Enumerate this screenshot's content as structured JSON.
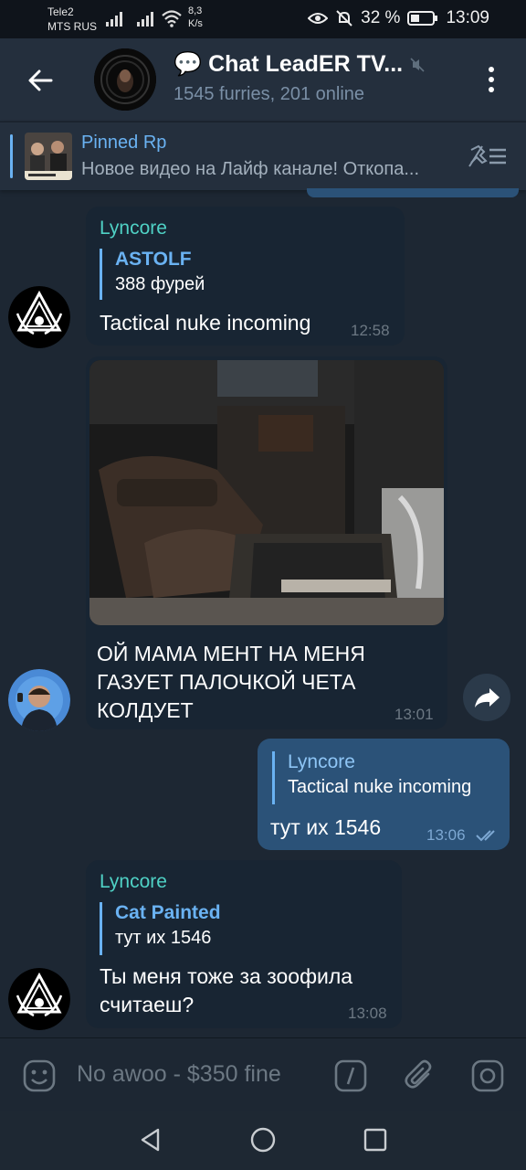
{
  "status_bar": {
    "carrier_1": "Tele2",
    "carrier_2": "MTS RUS",
    "speed_value": "8,3",
    "speed_unit": "K/s",
    "battery": "32 %",
    "time": "13:09"
  },
  "header": {
    "title": "💬 Chat LeadER TV...",
    "subtitle": "1545 furries, 201 online"
  },
  "pinned": {
    "title": "Pinned Rp",
    "text": "Новое видео на Лайф канале!  Откопа..."
  },
  "messages": [
    {
      "sender": "Lyncore",
      "reply_name": "ASTOLF",
      "reply_text": "388 фурей",
      "text": "Tactical nuke incoming",
      "time": "12:58"
    },
    {
      "text_line_1": "ОЙ МАМА МЕНТ НА МЕНЯ",
      "text_line_2": "ГАЗУЕТ ПАЛОЧКОЙ ЧЕТА",
      "text_line_3": "КОЛДУЕТ",
      "time": "13:01"
    },
    {
      "reply_name": "Lyncore",
      "reply_text": "Tactical nuke incoming",
      "text": "тут их 1546",
      "time": "13:06"
    },
    {
      "sender": "Lyncore",
      "reply_name": "Cat Painted",
      "reply_text": "тут их 1546",
      "text_line_1": "Ты меня тоже за зоофила",
      "text_line_2": "считаеш?",
      "time": "13:08"
    }
  ],
  "input": {
    "placeholder": "No awoo - $350 fine"
  },
  "colors": {
    "background": "#1d2733",
    "header": "#242f3d",
    "incoming_bubble": "#182533",
    "outgoing_bubble": "#2b5278",
    "accent": "#6ab2f2",
    "sender_name": "#4fd1c5"
  },
  "icons": [
    "back-arrow-icon",
    "mute-icon",
    "more-vertical-icon",
    "unpin-list-icon",
    "share-icon",
    "emoji-icon",
    "bot-command-icon",
    "attach-icon",
    "camera-icon",
    "nav-back-icon",
    "nav-home-icon",
    "nav-recents-icon"
  ]
}
